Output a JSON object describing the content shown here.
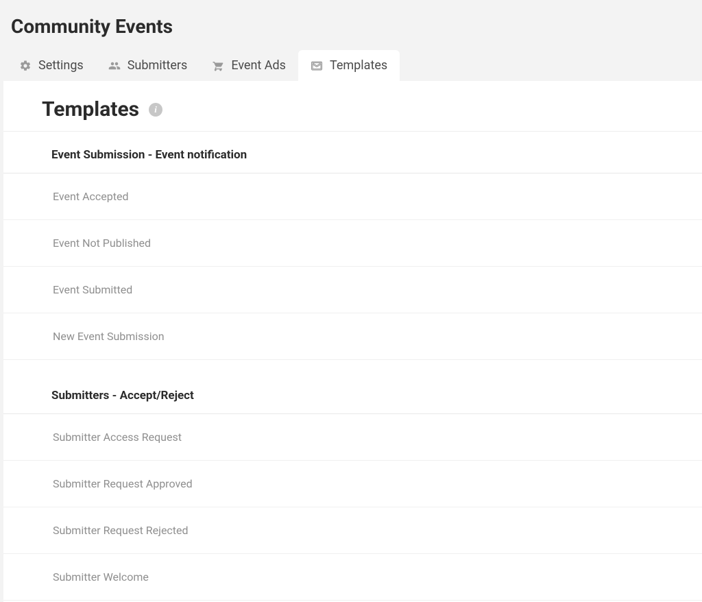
{
  "page_title": "Community Events",
  "tabs": [
    {
      "label": "Settings",
      "icon": "gear-icon",
      "active": false
    },
    {
      "label": "Submitters",
      "icon": "users-icon",
      "active": false
    },
    {
      "label": "Event Ads",
      "icon": "cart-icon",
      "active": false
    },
    {
      "label": "Templates",
      "icon": "envelope-icon",
      "active": true
    }
  ],
  "section_title": "Templates",
  "groups": [
    {
      "header": "Event Submission - Event notification",
      "items": [
        "Event Accepted",
        "Event Not Published",
        "Event Submitted",
        "New Event Submission"
      ]
    },
    {
      "header": "Submitters - Accept/Reject",
      "items": [
        "Submitter Access Request",
        "Submitter Request Approved",
        "Submitter Request Rejected",
        "Submitter Welcome"
      ]
    }
  ]
}
